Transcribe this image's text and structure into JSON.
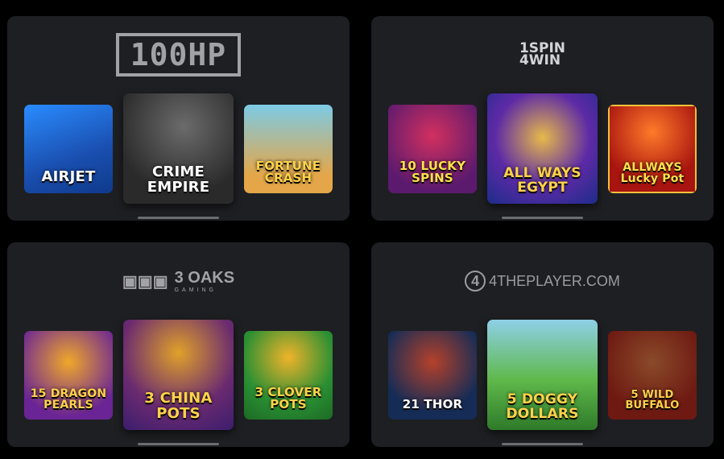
{
  "providers": [
    {
      "logo": "100HP",
      "games": [
        {
          "title": "AIRJET",
          "colors": [
            "#1a5fd8",
            "#2a8cff"
          ]
        },
        {
          "title": "CRIME EMPIRE",
          "colors": [
            "#2d2d2d",
            "#5b5b5b"
          ]
        },
        {
          "title": "FORTUNE CRASH",
          "colors": [
            "#5fb9d8",
            "#e6a24a"
          ]
        }
      ]
    },
    {
      "logo": {
        "line1": "1SPIN",
        "line2": "4WIN"
      },
      "games": [
        {
          "title": "10 LUCKY SPINS",
          "colors": [
            "#5c1a6e",
            "#b3206a"
          ]
        },
        {
          "title": "ALL WAYS EGYPT",
          "colors": [
            "#1d2c8a",
            "#7a3cc7"
          ]
        },
        {
          "title": "ALLWAYS Lucky Pot",
          "colors": [
            "#8a0f0f",
            "#e4371e"
          ]
        }
      ]
    },
    {
      "logo": {
        "name": "3 OAKS",
        "sub": "GAMING"
      },
      "games": [
        {
          "title": "15 DRAGON PEARLS",
          "colors": [
            "#6a2495",
            "#e07b1a"
          ]
        },
        {
          "title": "3 CHINA POTS",
          "colors": [
            "#3b1d6e",
            "#c05a1e"
          ]
        },
        {
          "title": "3 CLOVER POTS",
          "colors": [
            "#1c7a2a",
            "#59c637"
          ]
        }
      ]
    },
    {
      "logo": "4THEPLAYER.COM",
      "games": [
        {
          "title": "21 THOR",
          "colors": [
            "#142c56",
            "#3c6fb4"
          ]
        },
        {
          "title": "5 DOGGY DOLLARS",
          "colors": [
            "#3d9a3a",
            "#8ed0e8"
          ]
        },
        {
          "title": "5 WILD BUFFALO",
          "colors": [
            "#6e1a12",
            "#d0571f"
          ]
        }
      ]
    }
  ]
}
